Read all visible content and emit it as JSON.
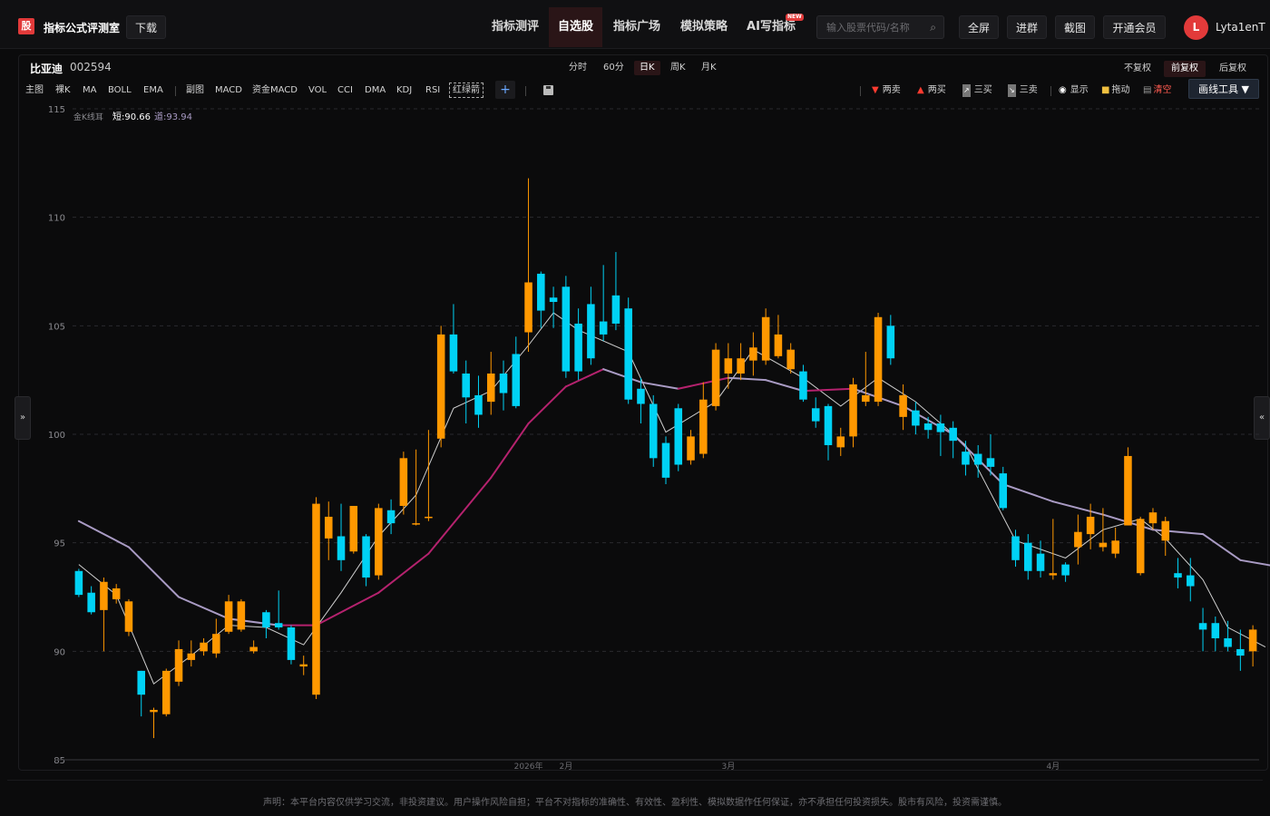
{
  "app": {
    "logo": "股",
    "title": "指标公式评测室",
    "download": "下载"
  },
  "nav": [
    {
      "label": "指标测评",
      "active": false
    },
    {
      "label": "自选股",
      "active": true
    },
    {
      "label": "指标广场",
      "active": false
    },
    {
      "label": "模拟策略",
      "active": false
    },
    {
      "label": "AI写指标",
      "active": false,
      "badge": "NEW"
    }
  ],
  "search": {
    "placeholder": "输入股票代码/名称",
    "value": ""
  },
  "header_buttons": {
    "fullscreen": "全屏",
    "join": "进群",
    "screenshot": "截图",
    "vip": "开通会员"
  },
  "user": {
    "avatar_letter": "L",
    "name": "Lyta1enT"
  },
  "stock": {
    "name": "比亚迪",
    "code": "002594"
  },
  "periods": [
    {
      "label": "分时",
      "active": false
    },
    {
      "label": "60分",
      "active": false
    },
    {
      "label": "日K",
      "active": true
    },
    {
      "label": "周K",
      "active": false
    },
    {
      "label": "月K",
      "active": false
    }
  ],
  "adjust": [
    {
      "label": "不复权",
      "active": false
    },
    {
      "label": "前复权",
      "active": true
    },
    {
      "label": "后复权",
      "active": false
    }
  ],
  "indicator_bar": {
    "main": "主图",
    "main_items": [
      "裸K",
      "MA",
      "BOLL",
      "EMA"
    ],
    "sub": "副图",
    "sub_items": [
      "MACD",
      "资金MACD",
      "VOL",
      "CCI",
      "DMA",
      "KDJ",
      "RSI"
    ],
    "boxed_item": "红绿箭"
  },
  "draw_tools": {
    "two_sell": "两卖",
    "two_buy": "两买",
    "three_buy": "三买",
    "three_sell": "三卖",
    "show": "显示",
    "drag": "拖动",
    "clear": "清空",
    "draw_tool_button": "画线工具 ▼"
  },
  "icons": {
    "two_sell": "down-triangle-icon",
    "two_buy": "up-triangle-icon",
    "three_buy": "chart-line-icon",
    "three_sell": "chart-line-icon",
    "show": "eye-icon",
    "drag": "lock-icon",
    "clear": "trash-icon",
    "save": "save-icon",
    "add": "plus-icon",
    "collapse_left": "double-chevron-right-icon",
    "collapse_right": "double-chevron-left-icon",
    "search": "search-icon"
  },
  "legend": {
    "name": "金K线耳",
    "short": "短:90.66",
    "long": "道:93.94"
  },
  "colors": {
    "up": "#ff9800",
    "down": "#00d2f5",
    "accent": "#e23a3a",
    "short_ma": "#cfcfcf",
    "long_ma_up": "#b5226e",
    "long_ma_down": "#a99bc4"
  },
  "chart_data": {
    "type": "candlestick",
    "ylim": [
      85,
      115
    ],
    "yticks": [
      115,
      110,
      105,
      100,
      95,
      90,
      85
    ],
    "xtick_labels": [
      {
        "label": "2026年",
        "index": 36
      },
      {
        "label": "2月",
        "index": 39
      },
      {
        "label": "3月",
        "index": 52
      },
      {
        "label": "4月",
        "index": 78
      }
    ],
    "candles": [
      [
        93.7,
        92.6,
        93.8,
        92.5
      ],
      [
        92.7,
        91.8,
        93.0,
        91.7
      ],
      [
        91.9,
        93.2,
        93.4,
        90.0
      ],
      [
        92.4,
        92.9,
        93.1,
        92.2
      ],
      [
        90.9,
        92.3,
        92.4,
        90.7
      ],
      [
        89.1,
        88.0,
        89.1,
        87.0
      ],
      [
        87.2,
        87.3,
        87.4,
        86.0
      ],
      [
        87.1,
        89.1,
        89.2,
        87.0
      ],
      [
        88.6,
        90.1,
        90.5,
        88.4
      ],
      [
        89.6,
        89.9,
        90.5,
        89.3
      ],
      [
        90.0,
        90.4,
        90.6,
        89.8
      ],
      [
        89.9,
        90.8,
        91.5,
        89.7
      ],
      [
        90.9,
        92.3,
        92.6,
        90.8
      ],
      [
        91.0,
        92.3,
        92.4,
        90.9
      ],
      [
        90.0,
        90.2,
        90.5,
        89.9
      ],
      [
        91.8,
        91.1,
        91.9,
        90.6
      ],
      [
        91.3,
        91.1,
        92.8,
        91.0
      ],
      [
        91.1,
        89.6,
        91.2,
        89.4
      ],
      [
        89.3,
        89.4,
        89.8,
        88.9
      ],
      [
        88.0,
        96.8,
        97.1,
        87.8
      ],
      [
        95.2,
        96.2,
        96.9,
        94.2
      ],
      [
        95.3,
        94.2,
        96.8,
        93.7
      ],
      [
        94.6,
        96.7,
        96.7,
        94.5
      ],
      [
        95.3,
        93.4,
        95.4,
        93.0
      ],
      [
        93.5,
        96.6,
        96.8,
        93.3
      ],
      [
        96.5,
        95.9,
        97.0,
        95.4
      ],
      [
        96.7,
        98.9,
        99.2,
        96.3
      ],
      [
        95.9,
        95.9,
        99.3,
        95.8
      ],
      [
        96.2,
        96.2,
        100.2,
        96.0
      ],
      [
        99.8,
        104.6,
        105.0,
        99.4
      ],
      [
        104.6,
        102.9,
        106.0,
        102.8
      ],
      [
        102.8,
        101.7,
        103.4,
        100.5
      ],
      [
        101.8,
        100.9,
        102.7,
        100.3
      ],
      [
        101.5,
        102.8,
        103.8,
        100.9
      ],
      [
        102.8,
        101.9,
        103.4,
        101.1
      ],
      [
        103.7,
        101.3,
        104.5,
        101.2
      ],
      [
        104.7,
        107.0,
        111.8,
        103.8
      ],
      [
        107.4,
        105.7,
        107.5,
        104.9
      ],
      [
        106.3,
        106.1,
        106.8,
        104.9
      ],
      [
        106.8,
        102.9,
        107.3,
        102.6
      ],
      [
        105.1,
        102.9,
        105.8,
        102.5
      ],
      [
        106.0,
        103.5,
        106.8,
        103.2
      ],
      [
        105.2,
        104.6,
        107.8,
        104.3
      ],
      [
        106.4,
        105.1,
        108.4,
        104.8
      ],
      [
        105.8,
        101.6,
        106.3,
        101.4
      ],
      [
        102.1,
        101.4,
        102.6,
        100.5
      ],
      [
        101.4,
        98.9,
        101.8,
        98.5
      ],
      [
        99.6,
        98.0,
        99.9,
        97.7
      ],
      [
        101.2,
        98.6,
        101.4,
        98.3
      ],
      [
        98.8,
        99.9,
        100.2,
        98.6
      ],
      [
        99.1,
        101.6,
        102.4,
        98.9
      ],
      [
        101.3,
        103.9,
        104.2,
        101.1
      ],
      [
        102.8,
        103.5,
        104.2,
        102.1
      ],
      [
        102.8,
        103.5,
        104.2,
        102.5
      ],
      [
        103.4,
        104.0,
        104.7,
        102.7
      ],
      [
        103.4,
        105.4,
        105.8,
        103.2
      ],
      [
        103.6,
        104.6,
        105.5,
        103.5
      ],
      [
        103.0,
        103.9,
        104.2,
        102.8
      ],
      [
        102.9,
        101.6,
        103.2,
        101.5
      ],
      [
        101.2,
        100.6,
        101.7,
        100.3
      ],
      [
        101.3,
        99.5,
        101.4,
        98.8
      ],
      [
        99.4,
        99.9,
        100.3,
        99.0
      ],
      [
        99.9,
        102.3,
        102.6,
        99.4
      ],
      [
        101.5,
        101.8,
        103.8,
        101.3
      ],
      [
        101.5,
        105.4,
        105.6,
        101.3
      ],
      [
        105.0,
        103.5,
        105.5,
        103.2
      ],
      [
        100.8,
        101.8,
        102.3,
        100.2
      ],
      [
        101.1,
        100.4,
        101.5,
        100.0
      ],
      [
        100.5,
        100.2,
        100.8,
        99.8
      ],
      [
        100.5,
        100.1,
        100.9,
        99.0
      ],
      [
        100.3,
        99.7,
        100.6,
        98.9
      ],
      [
        99.2,
        98.6,
        99.7,
        98.1
      ],
      [
        99.1,
        98.6,
        99.5,
        98.0
      ],
      [
        98.9,
        98.5,
        100.0,
        98.1
      ],
      [
        98.2,
        96.6,
        98.5,
        96.5
      ],
      [
        95.3,
        94.2,
        95.6,
        93.9
      ],
      [
        95.0,
        93.7,
        95.4,
        93.3
      ],
      [
        94.5,
        93.7,
        95.1,
        93.4
      ],
      [
        93.5,
        93.6,
        96.1,
        93.3
      ],
      [
        94.0,
        93.5,
        94.1,
        93.2
      ],
      [
        94.8,
        95.5,
        96.3,
        94.0
      ],
      [
        95.4,
        96.2,
        96.8,
        94.7
      ],
      [
        94.8,
        95.0,
        96.6,
        94.6
      ],
      [
        94.5,
        95.1,
        95.7,
        94.3
      ],
      [
        95.8,
        99.0,
        99.4,
        95.8
      ],
      [
        93.6,
        96.1,
        96.2,
        93.5
      ],
      [
        95.9,
        96.4,
        96.6,
        95.6
      ],
      [
        95.1,
        96.0,
        96.2,
        94.4
      ],
      [
        93.6,
        93.4,
        94.3,
        92.9
      ],
      [
        93.5,
        93.0,
        94.3,
        92.3
      ],
      [
        91.3,
        91.0,
        92.0,
        90.0
      ],
      [
        91.3,
        90.6,
        91.6,
        90.0
      ],
      [
        90.6,
        90.2,
        91.4,
        90.0
      ],
      [
        90.1,
        89.8,
        91.0,
        89.1
      ],
      [
        90.0,
        91.0,
        91.2,
        89.3
      ]
    ],
    "short_ma": [
      [
        0,
        94.0
      ],
      [
        3,
        92.6
      ],
      [
        6,
        88.5
      ],
      [
        9,
        89.8
      ],
      [
        12,
        91.2
      ],
      [
        15,
        91.1
      ],
      [
        18,
        90.3
      ],
      [
        21,
        92.7
      ],
      [
        24,
        95.3
      ],
      [
        27,
        97.2
      ],
      [
        30,
        101.2
      ],
      [
        33,
        102.0
      ],
      [
        36,
        104.1
      ],
      [
        38,
        105.6
      ],
      [
        40,
        104.8
      ],
      [
        44,
        103.8
      ],
      [
        47,
        100.1
      ],
      [
        51,
        101.5
      ],
      [
        54,
        103.9
      ],
      [
        58,
        102.6
      ],
      [
        61,
        101.3
      ],
      [
        64,
        102.6
      ],
      [
        67,
        101.5
      ],
      [
        71,
        99.5
      ],
      [
        75,
        95.1
      ],
      [
        79,
        94.3
      ],
      [
        82,
        95.6
      ],
      [
        85,
        96.1
      ],
      [
        87,
        95.2
      ],
      [
        90,
        93.3
      ],
      [
        92,
        91.1
      ],
      [
        95,
        90.2
      ]
    ],
    "long_ma": [
      [
        0,
        96.0
      ],
      [
        4,
        94.8
      ],
      [
        8,
        92.5
      ],
      [
        12,
        91.5
      ],
      [
        16,
        91.2
      ],
      [
        19,
        91.2
      ],
      [
        24,
        92.7
      ],
      [
        28,
        94.5
      ],
      [
        33,
        98.0
      ],
      [
        36,
        100.5
      ],
      [
        39,
        102.2
      ],
      [
        42,
        103.0
      ],
      [
        45,
        102.4
      ],
      [
        48,
        102.1
      ],
      [
        52,
        102.6
      ],
      [
        55,
        102.5
      ],
      [
        58,
        102.0
      ],
      [
        62,
        102.1
      ],
      [
        66,
        101.3
      ],
      [
        70,
        100.0
      ],
      [
        74,
        97.7
      ],
      [
        78,
        96.9
      ],
      [
        82,
        96.3
      ],
      [
        86,
        95.6
      ],
      [
        90,
        95.4
      ],
      [
        93,
        94.2
      ],
      [
        96,
        93.9
      ]
    ]
  },
  "footer": "声明：本平台内容仅供学习交流，非投资建议。用户操作风险自担；平台不对指标的准确性、有效性、盈利性、模拟数据作任何保证，亦不承担任何投资损失。股市有风险，投资需谨慎。"
}
